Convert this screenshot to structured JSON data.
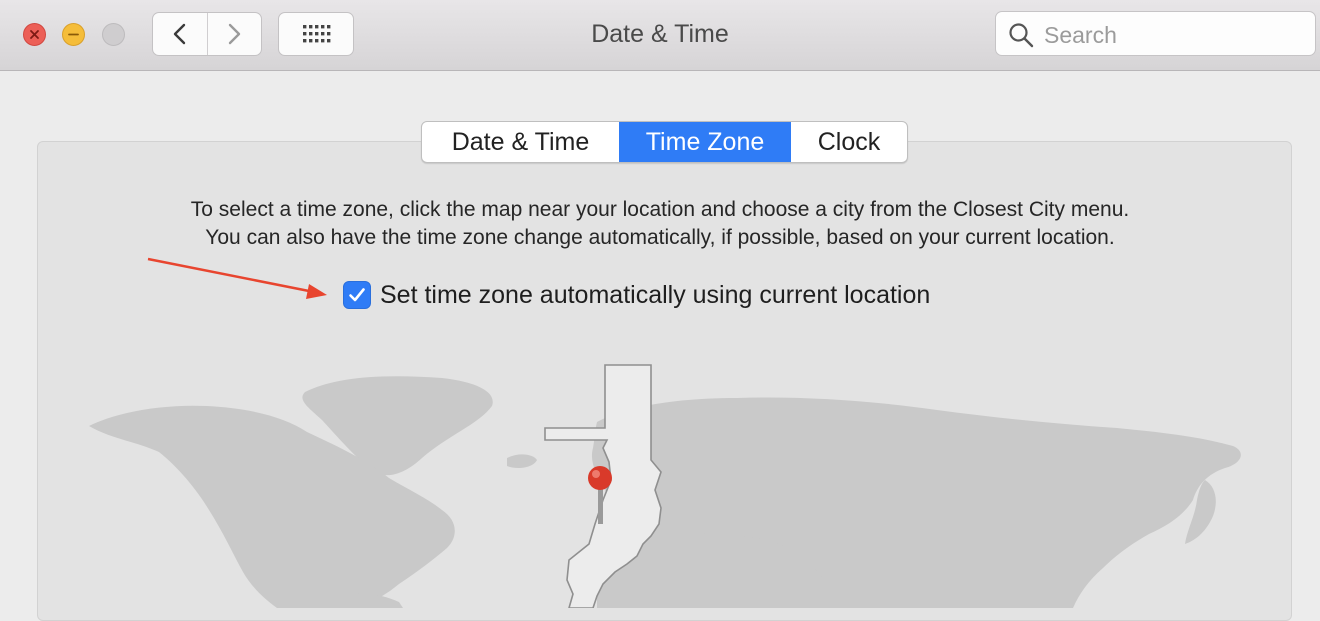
{
  "window": {
    "title": "Date & Time"
  },
  "toolbar": {
    "search_placeholder": "Search",
    "icons": [
      "close-icon",
      "minimize-icon",
      "zoom-icon",
      "chevron-left-icon",
      "chevron-right-icon",
      "grid-icon",
      "search-icon"
    ]
  },
  "tabs": [
    {
      "label": "Date & Time",
      "active": false
    },
    {
      "label": "Time Zone",
      "active": true
    },
    {
      "label": "Clock",
      "active": false
    }
  ],
  "timezone": {
    "description_line1": "To select a time zone, click the map near your location and choose a city from the Closest City menu.",
    "description_line2": "You can also have the time zone change automatically, if possible, based on your current location.",
    "auto_checkbox_label": "Set time zone automatically using current location",
    "auto_checked": true
  },
  "colors": {
    "accent": "#2f7cf6",
    "annotation_arrow": "#e8452f",
    "pin": "#d93a2a"
  }
}
